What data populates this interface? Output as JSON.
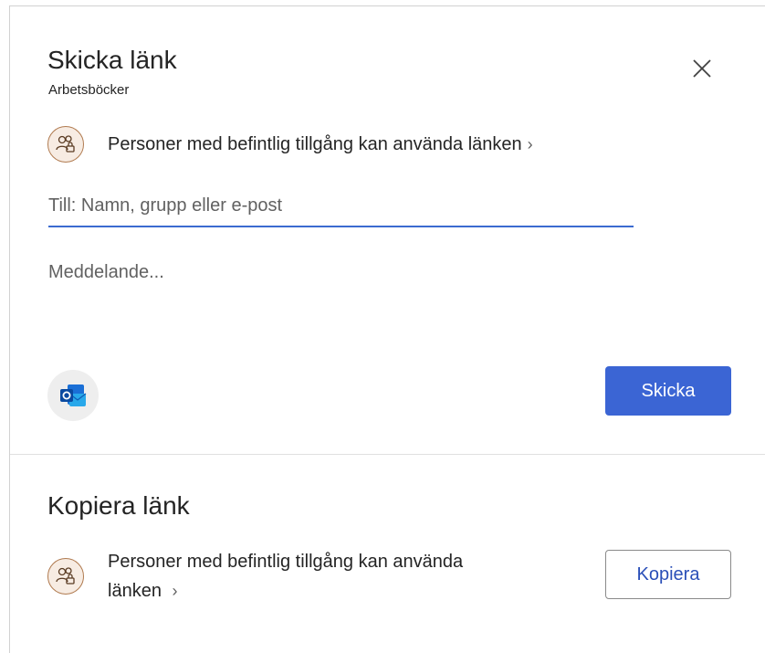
{
  "send_section": {
    "title": "Skicka länk",
    "subtitle": "Arbetsböcker",
    "permission_text": "Personer med befintlig tillgång kan använda länken",
    "to_placeholder": "Till: Namn, grupp eller e-post",
    "message_placeholder": "Meddelande...",
    "send_label": "Skicka",
    "send_color": "#3b65d4"
  },
  "copy_section": {
    "title": "Kopiera länk",
    "permission_text_line1": "Personer med befintlig tillgång kan använda",
    "permission_text_line2": "länken",
    "copy_label": "Kopiera"
  },
  "icons": {
    "close": "close-icon",
    "people": "people-lock-icon",
    "chevron": "chevron-right-icon",
    "outlook": "outlook-icon"
  }
}
